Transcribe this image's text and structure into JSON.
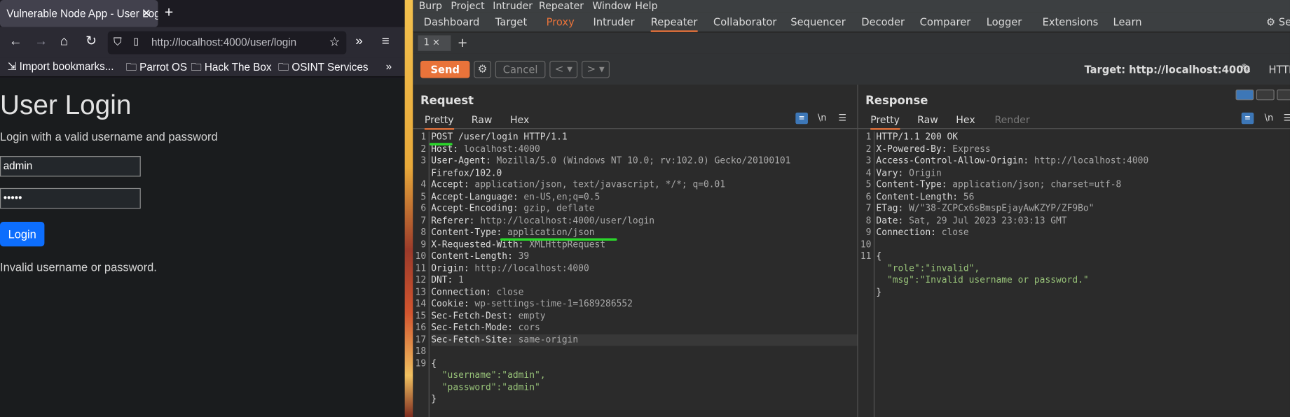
{
  "firefox": {
    "tab_title": "Vulnerable Node App - User Login",
    "url": "http://localhost:4000/user/login",
    "bookmarks": [
      "Import bookmarks...",
      "Parrot OS",
      "Hack The Box",
      "OSINT Services"
    ],
    "page": {
      "title": "User Login",
      "subtitle": "Login with a valid username and password",
      "username_value": "admin",
      "password_mask": "•••••",
      "login_label": "Login",
      "error": "Invalid username or password."
    }
  },
  "burp": {
    "menu": [
      "Burp",
      "Project",
      "Intruder",
      "Repeater",
      "Window",
      "Help"
    ],
    "tools": [
      "Dashboard",
      "Target",
      "Proxy",
      "Intruder",
      "Repeater",
      "Collaborator",
      "Sequencer",
      "Decoder",
      "Comparer",
      "Logger",
      "Extensions",
      "Learn"
    ],
    "settings_label": "Se",
    "active_tool": "Repeater",
    "subtab": "1 ×",
    "send": "Send",
    "cancel": "Cancel",
    "target": "Target: http://localhost:4000",
    "protocol": "HTTP",
    "request": {
      "title": "Request",
      "tabs": [
        "Pretty",
        "Raw",
        "Hex"
      ],
      "lines": [
        "POST /user/login HTTP/1.1",
        "Host: localhost:4000",
        "User-Agent: Mozilla/5.0 (Windows NT 10.0; rv:102.0) Gecko/20100101",
        "Firefox/102.0",
        "Accept: application/json, text/javascript, */*; q=0.01",
        "Accept-Language: en-US,en;q=0.5",
        "Accept-Encoding: gzip, deflate",
        "Referer: http://localhost:4000/user/login",
        "Content-Type: application/json",
        "X-Requested-With: XMLHttpRequest",
        "Content-Length: 39",
        "Origin: http://localhost:4000",
        "DNT: 1",
        "Connection: close",
        "Cookie: wp-settings-time-1=1689286552",
        "Sec-Fetch-Dest: empty",
        "Sec-Fetch-Mode: cors",
        "Sec-Fetch-Site: same-origin",
        "",
        "{",
        "  \"username\":\"admin\",",
        "  \"password\":\"admin\"",
        "}"
      ],
      "line_numbers": [
        "1",
        "2",
        "3",
        "",
        "4",
        "5",
        "6",
        "7",
        "8",
        "9",
        "10",
        "11",
        "12",
        "13",
        "14",
        "15",
        "16",
        "17",
        "18",
        "19",
        "",
        "",
        ""
      ]
    },
    "response": {
      "title": "Response",
      "tabs": [
        "Pretty",
        "Raw",
        "Hex",
        "Render"
      ],
      "lines": [
        "HTTP/1.1 200 OK",
        "X-Powered-By: Express",
        "Access-Control-Allow-Origin: http://localhost:4000",
        "Vary: Origin",
        "Content-Type: application/json; charset=utf-8",
        "Content-Length: 56",
        "ETag: W/\"38-ZCPCx6sBmspEjayAwKZYP/ZF9Bo\"",
        "Date: Sat, 29 Jul 2023 23:03:13 GMT",
        "Connection: close",
        "",
        "{",
        "  \"role\":\"invalid\",",
        "  \"msg\":\"Invalid username or password.\"",
        "}"
      ],
      "line_numbers": [
        "1",
        "2",
        "3",
        "4",
        "5",
        "6",
        "7",
        "8",
        "9",
        "10",
        "11",
        "",
        "",
        ""
      ]
    },
    "colors": {
      "accent": "#e9733a",
      "highlight": "#2bd52b"
    }
  }
}
